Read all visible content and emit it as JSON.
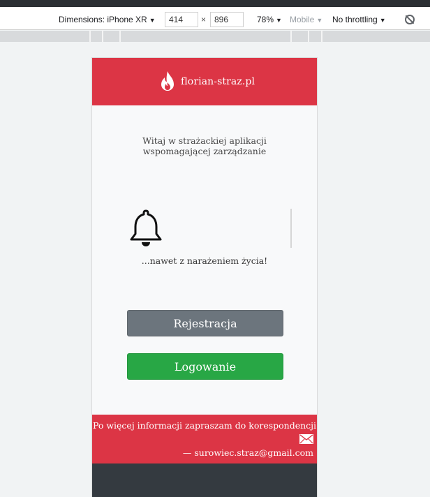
{
  "devtools": {
    "device_label": "Dimensions: iPhone XR",
    "width": "414",
    "times": "×",
    "height": "896",
    "zoom": "78%",
    "mode": "Mobile",
    "throttling": "No throttling",
    "rotate_icon": "rotate-icon"
  },
  "app": {
    "brand": "florian-straz.pl",
    "welcome": "Witaj w strażackiej aplikacji wspomagającej zarządzanie",
    "carousel_caption": "...nawet z narażeniem życia!",
    "register_label": "Rejestracja",
    "login_label": "Logowanie",
    "footer_text": "Po więcej informacji zapraszam do korespondencji",
    "footer_email": "— surowiec.straz@gmail.com",
    "colors": {
      "header": "#dc3545",
      "register": "#6c757d",
      "login": "#28a745",
      "footer_dark": "#343a40"
    },
    "icons": [
      "fire-icon",
      "bell-icon",
      "envelope-icon"
    ]
  }
}
